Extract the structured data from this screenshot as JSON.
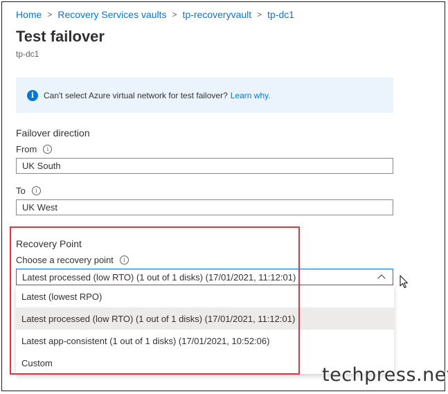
{
  "breadcrumb": {
    "items": [
      "Home",
      "Recovery Services vaults",
      "tp-recoveryvault",
      "tp-dc1"
    ],
    "separator": ">"
  },
  "page": {
    "title": "Test failover",
    "subtitle": "tp-dc1"
  },
  "info_banner": {
    "message": "Can't select Azure virtual network for test failover?",
    "link": "Learn why.",
    "icon": "info-icon"
  },
  "failover_direction": {
    "heading": "Failover direction",
    "from_label": "From",
    "from_value": "UK South",
    "to_label": "To",
    "to_value": "UK West"
  },
  "recovery_point": {
    "heading": "Recovery Point",
    "label": "Choose a recovery point",
    "selected": "Latest processed (low RTO) (1 out of 1 disks) (17/01/2021, 11:12:01)",
    "options": [
      "Latest (lowest RPO)",
      "Latest processed (low RTO) (1 out of 1 disks) (17/01/2021, 11:12:01)",
      "Latest app-consistent (1 out of 1 disks) (17/01/2021, 10:52:06)",
      "Custom"
    ],
    "selected_index": 1
  },
  "watermark": "techpress.net",
  "colors": {
    "accent": "#0078d4",
    "banner_bg": "#ebf3fc",
    "highlight": "#e5323f",
    "selected_bg": "#edebe9"
  }
}
